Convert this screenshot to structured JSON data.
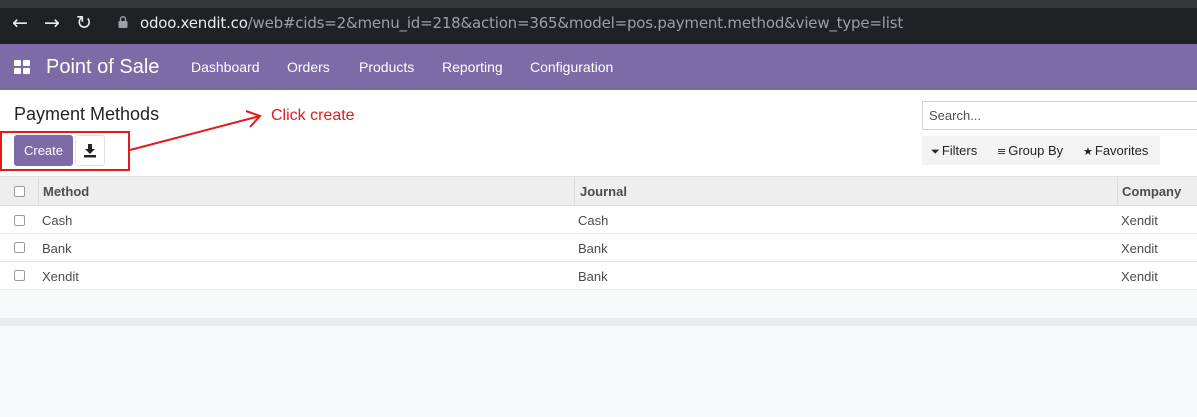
{
  "browser": {
    "url_host": "odoo.xendit.co",
    "url_path": "/web#cids=2&menu_id=218&action=365&model=pos.payment.method&view_type=list"
  },
  "navbar": {
    "app_title": "Point of Sale",
    "menu": [
      "Dashboard",
      "Orders",
      "Products",
      "Reporting",
      "Configuration"
    ]
  },
  "control_panel": {
    "title": "Payment Methods",
    "create_label": "Create",
    "annotation": "Click create",
    "search_placeholder": "Search...",
    "filters_label": "Filters",
    "group_by_label": "Group By",
    "favorites_label": "Favorites"
  },
  "list": {
    "columns": [
      "Method",
      "Journal",
      "Company"
    ],
    "rows": [
      {
        "method": "Cash",
        "journal": "Cash",
        "company": "Xendit"
      },
      {
        "method": "Bank",
        "journal": "Bank",
        "company": "Xendit"
      },
      {
        "method": "Xendit",
        "journal": "Bank",
        "company": "Xendit"
      }
    ]
  },
  "colors": {
    "brand": "#7c6ba7",
    "annotation": "#e31b1b"
  }
}
